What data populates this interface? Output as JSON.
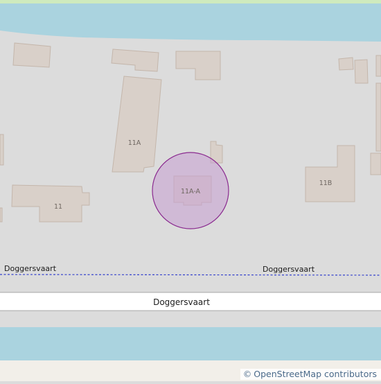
{
  "map": {
    "colors": {
      "land": "#dcdcdc",
      "grass": "#cfeabd",
      "water": "#aad3df",
      "building_fill": "#d9d0c9",
      "building_stroke": "#c4b6ab",
      "road_fill": "#ffffff",
      "road_casing": "#bcbcbc",
      "boundary": "#3340cc",
      "highlight_fill": "#c79ed1",
      "highlight_stroke": "#8a2a8f",
      "bottom_land": "#f2efe9"
    },
    "buildings": [
      {
        "label": ""
      },
      {
        "label": ""
      },
      {
        "label": ""
      },
      {
        "label": ""
      },
      {
        "label": ""
      },
      {
        "label": "11A"
      },
      {
        "label": ""
      },
      {
        "label": "11"
      },
      {
        "label": ""
      },
      {
        "label": ""
      },
      {
        "label": ""
      },
      {
        "label": "11B"
      },
      {
        "label": ""
      },
      {
        "label": ""
      },
      {
        "label": "11A-A"
      }
    ],
    "water_labels": {
      "left": "Doggersvaart",
      "right": "Doggersvaart"
    },
    "road": {
      "name": "Doggersvaart"
    },
    "attribution": {
      "symbol": "©",
      "text": "OpenStreetMap contributors"
    }
  }
}
